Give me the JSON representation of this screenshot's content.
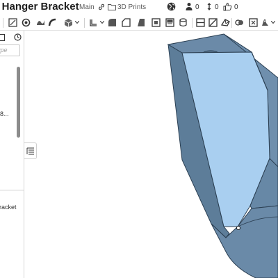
{
  "document": {
    "title": "el Hanger Bracket",
    "branch": "Main",
    "folder": "3D Prints"
  },
  "header_stats": {
    "people_count": "0",
    "versions_count": "0",
    "likes_count": "0"
  },
  "toolbar": {
    "icons": [
      "sketch-icon",
      "extrude-icon",
      "revolve-icon",
      "sweep-icon",
      "loft-icon",
      "thicken-icon",
      "fillet-icon",
      "chamfer-icon",
      "draft-icon",
      "shell-icon",
      "rib-icon",
      "hole-icon",
      "linear-pattern-icon",
      "mirror-icon",
      "boolean-icon",
      "split-icon",
      "transform-icon",
      "delete-part-icon",
      "modify-fillet-icon",
      "plane-icon",
      "mate-connector-icon",
      "variable-icon"
    ]
  },
  "left_panel": {
    "filter_placeholder": "ype",
    "feature_truncated": "8...",
    "part_truncated": "racket"
  },
  "colors": {
    "model_face_front": "#a9cff0",
    "model_face_dark": "#5f7f9b",
    "model_face_mid": "#6d8dab",
    "edge": "#2b3f52",
    "accent": "#2a6fd6"
  }
}
